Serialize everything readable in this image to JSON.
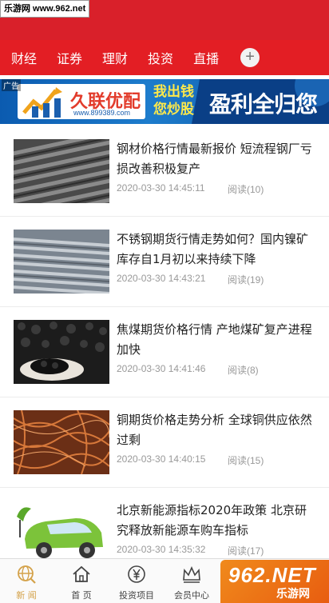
{
  "watermark_top": "乐游网 www.962.net",
  "nav": {
    "items": [
      "财经",
      "证券",
      "理财",
      "投资",
      "直播"
    ],
    "add_icon": "+"
  },
  "ad": {
    "tag": "广告",
    "brand": "久联优配",
    "url": "www.899389.com",
    "slogan_1": "我出钱您炒股",
    "slogan_2": "盈利全归您"
  },
  "news": [
    {
      "title": "钢材价格行情最新报价 短流程钢厂亏损改善积极复产",
      "date": "2020-03-30 14:45:11",
      "reads": "阅读(10)",
      "thumb": "rebar-bundle"
    },
    {
      "title": "不锈钢期货行情走势如何？国内镍矿库存自1月初以来持续下降",
      "date": "2020-03-30 14:43:21",
      "reads": "阅读(19)",
      "thumb": "steel-rods"
    },
    {
      "title": "焦煤期货价格行情 产地煤矿复产进程加快",
      "date": "2020-03-30 14:41:46",
      "reads": "阅读(8)",
      "thumb": "coal-pile"
    },
    {
      "title": "铜期货价格走势分析 全球铜供应依然过剩",
      "date": "2020-03-30 14:40:15",
      "reads": "阅读(15)",
      "thumb": "copper-wire"
    },
    {
      "title": "北京新能源指标2020年政策 北京研究释放新能源车购车指标",
      "date": "2020-03-30 14:35:32",
      "reads": "阅读(17)",
      "thumb": "green-car"
    }
  ],
  "tabbar": {
    "items": [
      {
        "label": "新 闻",
        "icon": "globe-icon",
        "active": true
      },
      {
        "label": "首 页",
        "icon": "home-icon",
        "active": false
      },
      {
        "label": "投资项目",
        "icon": "yen-icon",
        "active": false
      },
      {
        "label": "会员中心",
        "icon": "crown-icon",
        "active": false
      }
    ]
  },
  "watermark_bottom": {
    "main": "962.NET",
    "sub": "乐游网"
  },
  "colors": {
    "nav_red": "#e31e24",
    "accent_gold": "#d4a24a"
  }
}
